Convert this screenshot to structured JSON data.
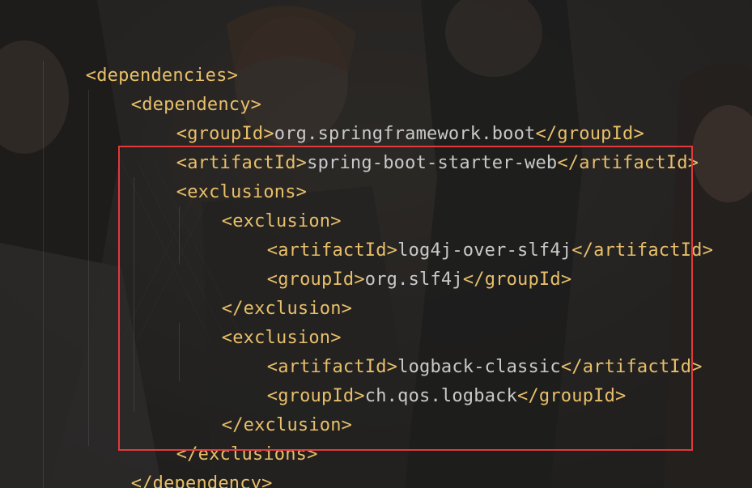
{
  "editor": {
    "lines": [
      {
        "open": "<dependencies>",
        "value": "",
        "close": ""
      },
      {
        "open": "<dependency>",
        "value": "",
        "close": ""
      },
      {
        "open": "<groupId>",
        "value": "org.springframework.boot",
        "close": "</groupId>"
      },
      {
        "open": "<artifactId>",
        "value": "spring-boot-starter-web",
        "close": "</artifactId>"
      },
      {
        "open": "<exclusions>",
        "value": "",
        "close": ""
      },
      {
        "open": "<exclusion>",
        "value": "",
        "close": ""
      },
      {
        "open": "<artifactId>",
        "value": "log4j-over-slf4j",
        "close": "</artifactId>"
      },
      {
        "open": "<groupId>",
        "value": "org.slf4j",
        "close": "</groupId>"
      },
      {
        "open": "</exclusion>",
        "value": "",
        "close": ""
      },
      {
        "open": "<exclusion>",
        "value": "",
        "close": ""
      },
      {
        "open": "<artifactId>",
        "value": "logback-classic",
        "close": "</artifactId>"
      },
      {
        "open": "<groupId>",
        "value": "ch.qos.logback",
        "close": "</groupId>"
      },
      {
        "open": "</exclusion>",
        "value": "",
        "close": ""
      },
      {
        "open": "</exclusions>",
        "value": "",
        "close": ""
      },
      {
        "open": "</dependency>",
        "value": "",
        "close": ""
      }
    ]
  },
  "colors": {
    "tag": "#e8bf6a",
    "text": "#c9c9c9",
    "highlight": "#e03a3a"
  }
}
